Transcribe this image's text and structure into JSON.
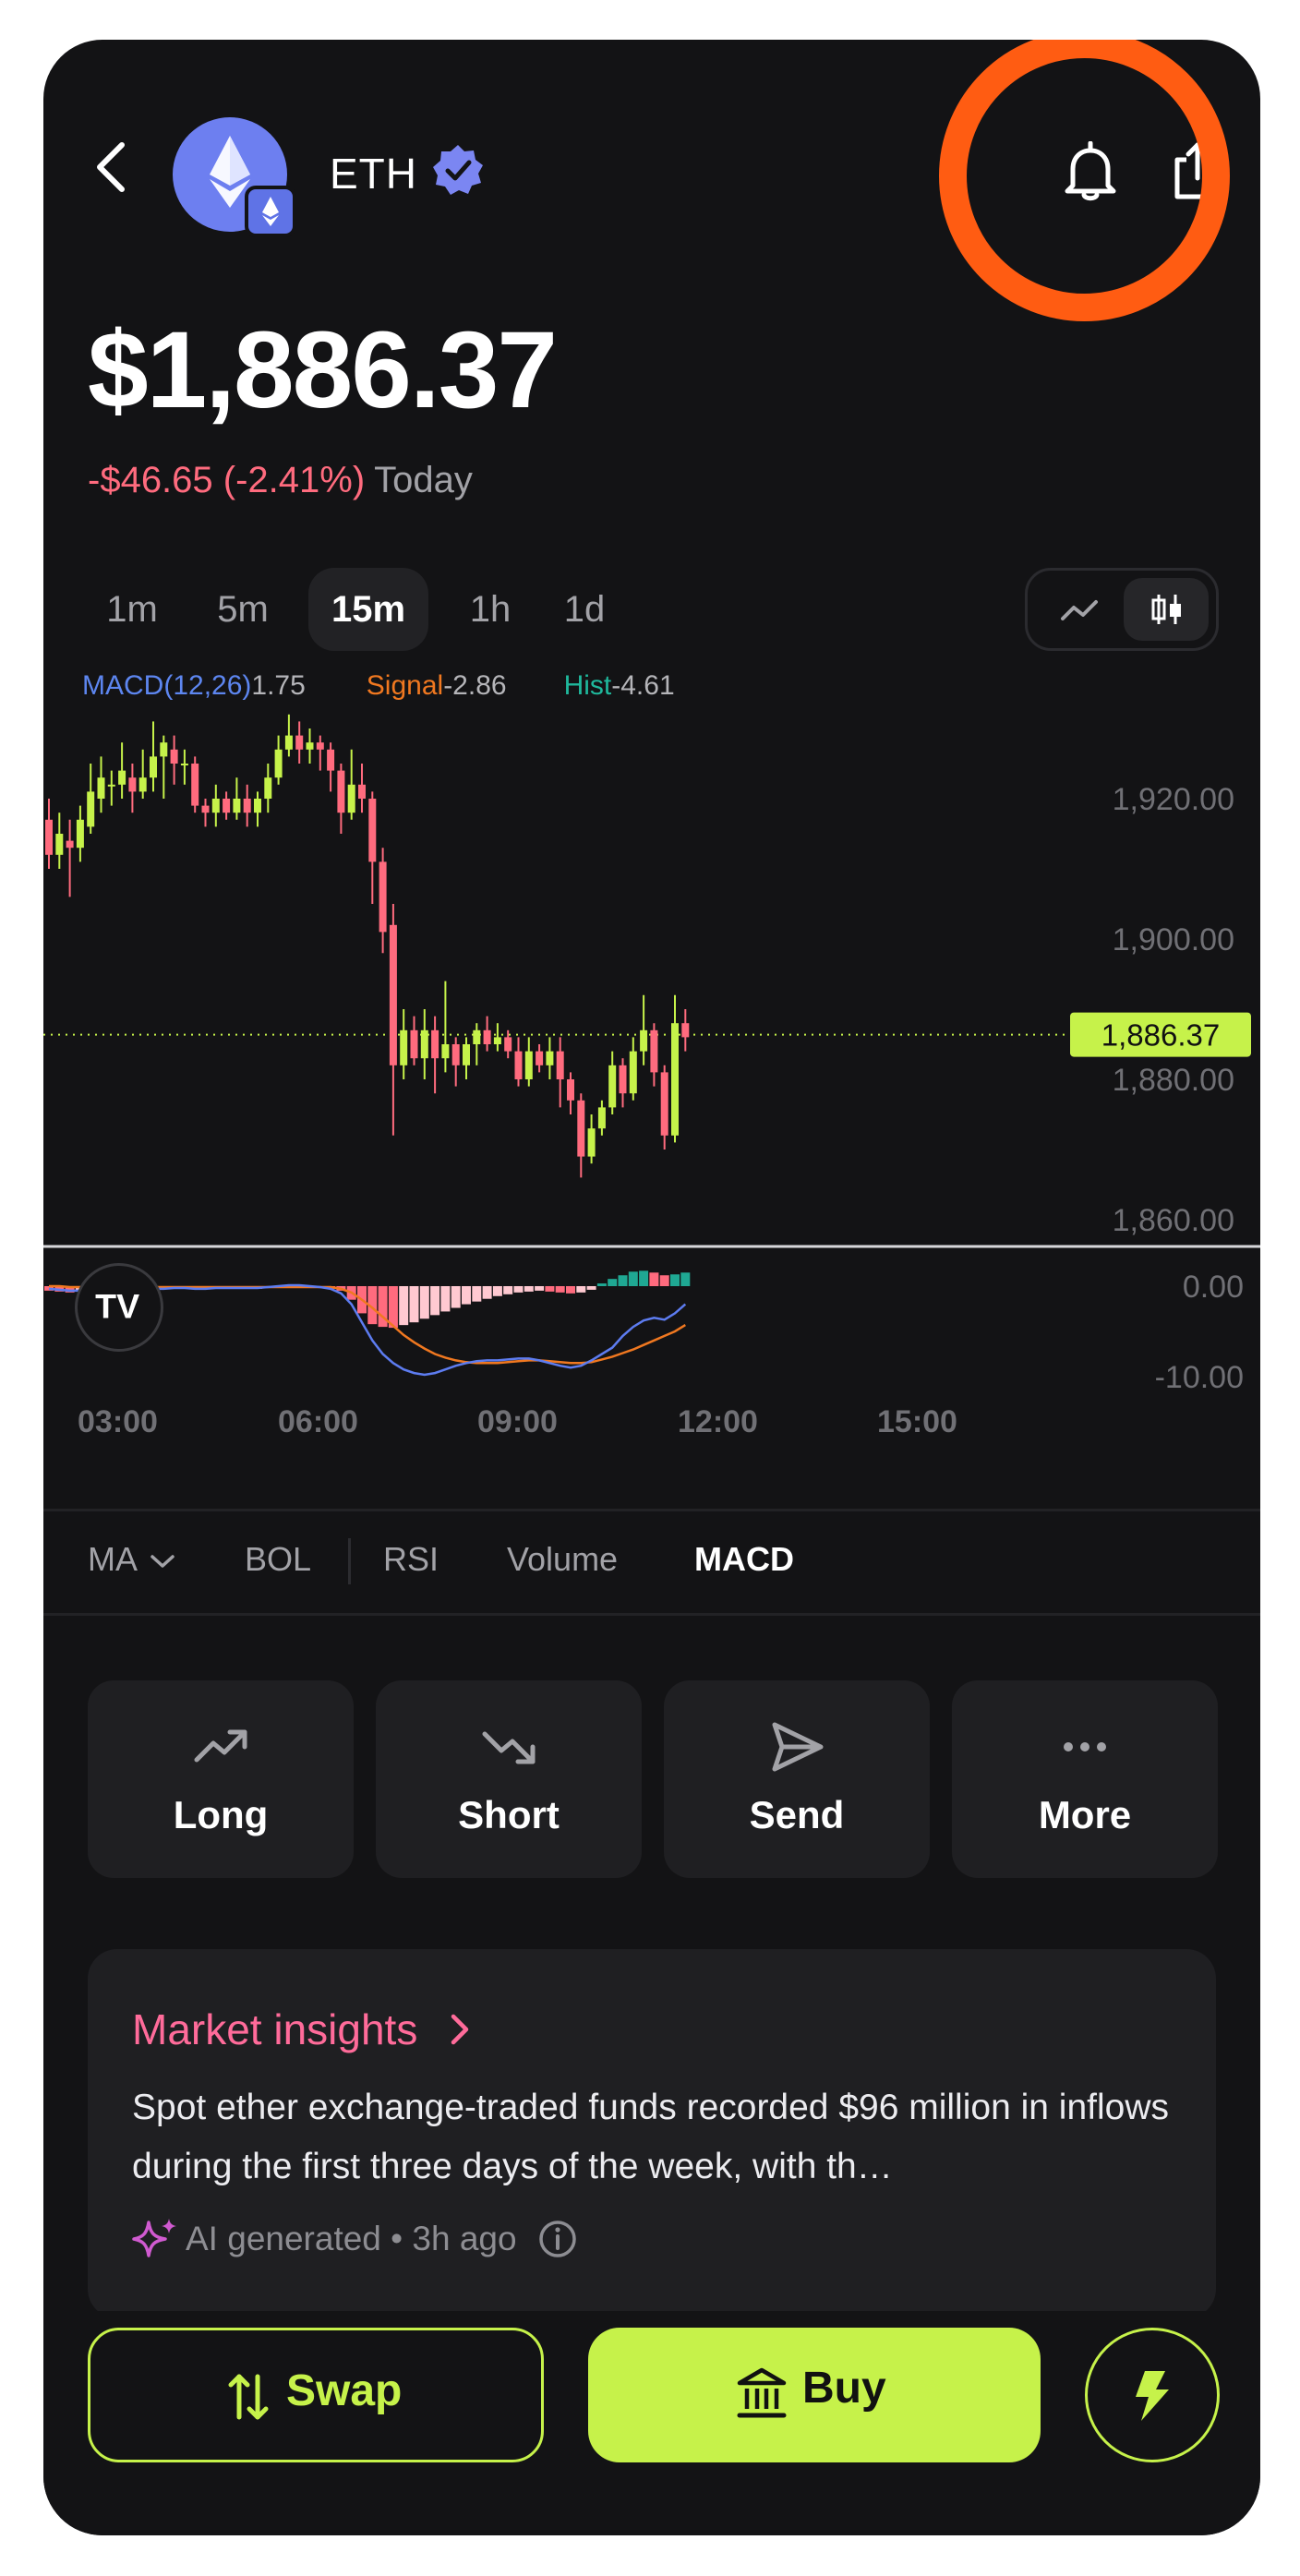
{
  "header": {
    "ticker": "ETH"
  },
  "price": {
    "value": "$1,886.37",
    "change": "-$46.65 (-2.41%)",
    "period": "Today"
  },
  "timeframes": [
    "1m",
    "5m",
    "15m",
    "1h",
    "1d"
  ],
  "active_timeframe": "15m",
  "chart_types": {
    "line_icon": "line-chart-icon",
    "candle_icon": "candlestick-icon",
    "active": "candles"
  },
  "macd_legend": {
    "macd_label": "MACD(12,26)",
    "macd_value": "1.75",
    "signal_label": "Signal",
    "signal_value": "-2.86",
    "hist_label": "Hist",
    "hist_value": "-4.61"
  },
  "indicators": [
    "MA",
    "BOL",
    "RSI",
    "Volume",
    "MACD"
  ],
  "active_indicator": "MACD",
  "actions": [
    {
      "label": "Long",
      "icon": "trending-up-icon"
    },
    {
      "label": "Short",
      "icon": "trending-down-icon"
    },
    {
      "label": "Send",
      "icon": "send-icon"
    },
    {
      "label": "More",
      "icon": "more-icon"
    }
  ],
  "insights": {
    "title": "Market insights",
    "body": "Spot ether exchange-traded funds recorded $96 million in inflows during the first three days of the week, with th…",
    "meta": "AI generated • 3h ago"
  },
  "bottom": {
    "swap_label": "Swap",
    "buy_label": "Buy"
  },
  "colors": {
    "accent": "#c6f24a",
    "up": "#c6f24a",
    "down": "#ff6b7e",
    "macd": "#5d7cf0",
    "signal": "#f07820",
    "hist_up": "#1fa893",
    "annotation": "#ff5c12"
  },
  "chart_data": {
    "type": "candlestick",
    "price_axis": {
      "ticks": [
        1920,
        1900,
        1880,
        1860
      ],
      "tick_labels": [
        "1,920.00",
        "1,900.00",
        "1,880.00",
        "1,860.00"
      ],
      "current": 1886.37,
      "current_label": "1,886.37"
    },
    "macd_axis": {
      "ticks": [
        0,
        -10
      ],
      "tick_labels": [
        "0.00",
        "-10.00"
      ]
    },
    "time_labels": [
      "03:00",
      "06:00",
      "09:00",
      "12:00",
      "15:00"
    ],
    "candles": [
      [
        1917,
        1912,
        1920,
        1910
      ],
      [
        1912,
        1915,
        1918,
        1910
      ],
      [
        1914,
        1913,
        1917,
        1906
      ],
      [
        1913,
        1917,
        1919,
        1911
      ],
      [
        1916,
        1921,
        1925,
        1915
      ],
      [
        1920,
        1923,
        1926,
        1918
      ],
      [
        1922,
        1922,
        1924,
        1919
      ],
      [
        1922,
        1924,
        1928,
        1920
      ],
      [
        1923,
        1921,
        1925,
        1918
      ],
      [
        1921,
        1923,
        1927,
        1920
      ],
      [
        1923,
        1926,
        1931,
        1921
      ],
      [
        1926,
        1928,
        1929,
        1920
      ],
      [
        1927,
        1925,
        1929,
        1922
      ],
      [
        1925,
        1925,
        1927,
        1922
      ],
      [
        1925,
        1919,
        1926,
        1918
      ],
      [
        1919,
        1918,
        1920,
        1916
      ],
      [
        1918,
        1920,
        1922,
        1916
      ],
      [
        1920,
        1918,
        1921,
        1917
      ],
      [
        1918,
        1920,
        1923,
        1917
      ],
      [
        1920,
        1918,
        1922,
        1916
      ],
      [
        1918,
        1920,
        1921,
        1916
      ],
      [
        1920,
        1923,
        1925,
        1918
      ],
      [
        1923,
        1927,
        1929,
        1922
      ],
      [
        1927,
        1929,
        1932,
        1926
      ],
      [
        1929,
        1927,
        1931,
        1925
      ],
      [
        1927,
        1928,
        1930,
        1925
      ],
      [
        1928,
        1927,
        1929,
        1924
      ],
      [
        1927,
        1924,
        1928,
        1921
      ],
      [
        1924,
        1918,
        1925,
        1915
      ],
      [
        1918,
        1922,
        1927,
        1917
      ],
      [
        1922,
        1920,
        1925,
        1918
      ],
      [
        1920,
        1911,
        1921,
        1905
      ],
      [
        1911,
        1901,
        1913,
        1898
      ],
      [
        1902,
        1882,
        1905,
        1872
      ],
      [
        1882,
        1887,
        1890,
        1880
      ],
      [
        1887,
        1883,
        1889,
        1882
      ],
      [
        1883,
        1887,
        1890,
        1880
      ],
      [
        1887,
        1883,
        1889,
        1878
      ],
      [
        1883,
        1885,
        1894,
        1881
      ],
      [
        1885,
        1882,
        1886,
        1879
      ],
      [
        1882,
        1885,
        1886,
        1880
      ],
      [
        1885,
        1887,
        1888,
        1882
      ],
      [
        1887,
        1885,
        1889,
        1884
      ],
      [
        1885,
        1886,
        1888,
        1884
      ],
      [
        1886,
        1884,
        1887,
        1883
      ],
      [
        1884,
        1880,
        1886,
        1879
      ],
      [
        1880,
        1884,
        1886,
        1879
      ],
      [
        1884,
        1882,
        1885,
        1881
      ],
      [
        1882,
        1884,
        1886,
        1880
      ],
      [
        1884,
        1880,
        1886,
        1876
      ],
      [
        1880,
        1877,
        1881,
        1875
      ],
      [
        1877,
        1869,
        1878,
        1866
      ],
      [
        1869,
        1873,
        1875,
        1868
      ],
      [
        1873,
        1876,
        1877,
        1872
      ],
      [
        1876,
        1882,
        1884,
        1875
      ],
      [
        1882,
        1878,
        1883,
        1876
      ],
      [
        1878,
        1884,
        1886,
        1877
      ],
      [
        1884,
        1887,
        1892,
        1882
      ],
      [
        1887,
        1881,
        1888,
        1879
      ],
      [
        1881,
        1872,
        1882,
        1870
      ],
      [
        1872,
        1888,
        1892,
        1871
      ],
      [
        1888,
        1886,
        1890,
        1884
      ]
    ],
    "macd": {
      "histogram": [
        -0.5,
        -0.6,
        -0.7,
        -0.6,
        -0.5,
        -0.4,
        -0.3,
        -0.3,
        -0.2,
        -0.2,
        -0.3,
        -0.3,
        -0.2,
        -0.2,
        -0.3,
        -0.3,
        -0.2,
        -0.2,
        -0.2,
        -0.3,
        -0.3,
        -0.2,
        -0.2,
        -0.2,
        -0.2,
        -0.1,
        -0.2,
        -0.3,
        -0.5,
        -1.5,
        -3.0,
        -4.2,
        -4.5,
        -4.6,
        -4.3,
        -4.0,
        -3.6,
        -3.2,
        -2.8,
        -2.4,
        -2.0,
        -1.7,
        -1.4,
        -1.1,
        -0.9,
        -0.7,
        -0.6,
        -0.5,
        -0.6,
        -0.7,
        -0.8,
        -0.7,
        -0.4,
        0.3,
        0.8,
        1.2,
        1.6,
        1.7,
        1.5,
        1.2,
        1.3,
        1.5
      ],
      "macd_line": [
        -0.3,
        -0.4,
        -0.5,
        -0.5,
        -0.4,
        -0.3,
        -0.3,
        -0.2,
        -0.2,
        -0.2,
        -0.3,
        -0.3,
        -0.2,
        -0.2,
        -0.3,
        -0.3,
        -0.2,
        -0.2,
        -0.2,
        -0.2,
        -0.2,
        -0.1,
        0.0,
        0.1,
        0.1,
        0.0,
        -0.1,
        -0.3,
        -0.8,
        -2.0,
        -4.0,
        -6.0,
        -7.5,
        -8.5,
        -9.2,
        -9.6,
        -9.8,
        -9.6,
        -9.2,
        -8.8,
        -8.5,
        -8.3,
        -8.2,
        -8.2,
        -8.1,
        -8.0,
        -8.0,
        -8.2,
        -8.5,
        -8.8,
        -9.0,
        -8.8,
        -8.2,
        -7.5,
        -6.8,
        -5.5,
        -4.5,
        -3.8,
        -3.5,
        -3.7,
        -3.0,
        -2.0
      ],
      "signal_line": [
        0.0,
        0.0,
        -0.1,
        -0.1,
        -0.1,
        -0.1,
        -0.1,
        -0.1,
        -0.1,
        -0.1,
        -0.1,
        -0.1,
        -0.1,
        -0.1,
        -0.1,
        -0.1,
        -0.1,
        -0.1,
        -0.1,
        -0.1,
        -0.1,
        -0.1,
        -0.1,
        -0.1,
        -0.1,
        -0.1,
        -0.1,
        -0.1,
        -0.3,
        -0.7,
        -1.5,
        -2.4,
        -3.4,
        -4.4,
        -5.4,
        -6.2,
        -6.9,
        -7.5,
        -7.9,
        -8.2,
        -8.4,
        -8.5,
        -8.5,
        -8.5,
        -8.4,
        -8.3,
        -8.2,
        -8.2,
        -8.3,
        -8.4,
        -8.5,
        -8.5,
        -8.4,
        -8.1,
        -7.8,
        -7.4,
        -7.0,
        -6.5,
        -6.0,
        -5.5,
        -5.0,
        -4.3
      ]
    }
  }
}
